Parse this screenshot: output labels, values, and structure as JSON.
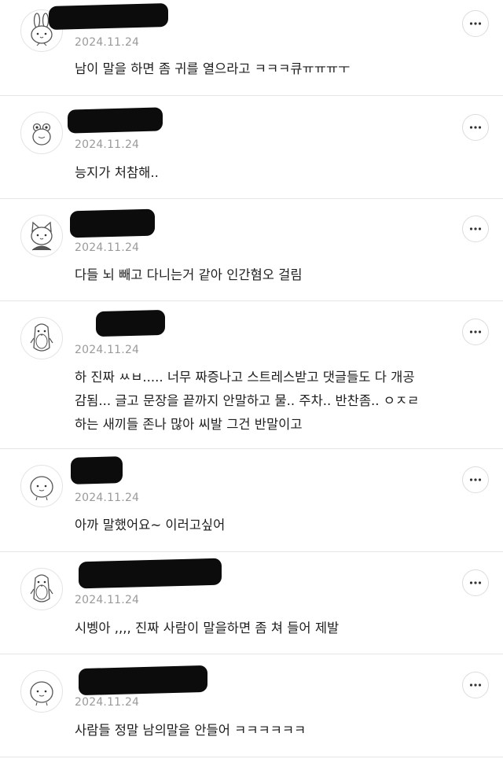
{
  "comments": [
    {
      "date": "2024.11.24",
      "text": "남이 말을 하면 좀 귀를 열으라고 ㅋㅋㅋ큐ㅠㅠㅠㅜ",
      "avatar_icon": "bunny-avatar-icon",
      "more_icon": "more-options-icon"
    },
    {
      "date": "2024.11.24",
      "text": "능지가 처참해..",
      "avatar_icon": "frog-avatar-icon",
      "more_icon": "more-options-icon"
    },
    {
      "date": "2024.11.24",
      "text": "다들 뇌 빼고 다니는거 같아 인간혐오 걸림",
      "avatar_icon": "cat-avatar-icon",
      "more_icon": "more-options-icon"
    },
    {
      "date": "2024.11.24",
      "text": "하 진짜 ㅆㅂ..... 너무 짜증나고 스트레스받고 댓글들도 다 개공\n감됨... 글고 문장을 끝까지 안말하고 물.. 주차.. 반찬좀.. ㅇㅈㄹ\n하는 새끼들 존나 많아 씨발 그건 반말이고",
      "avatar_icon": "penguin-avatar-icon",
      "more_icon": "more-options-icon"
    },
    {
      "date": "2024.11.24",
      "text": "아까 말했어요~ 이러고싶어",
      "avatar_icon": "blob-avatar-icon",
      "more_icon": "more-options-icon"
    },
    {
      "date": "2024.11.24",
      "text": "시벵아 ,,,, 진짜 사람이 말을하면 좀 쳐 들어 제발",
      "avatar_icon": "penguin-avatar-icon",
      "more_icon": "more-options-icon"
    },
    {
      "date": "2024.11.24",
      "text": "사람들 정말 남의말을 안들어 ㅋㅋㅋㅋㅋㅋ",
      "avatar_icon": "blob-avatar-icon",
      "more_icon": "more-options-icon"
    }
  ],
  "colors": {
    "date": "#9a9a9a",
    "text": "#1e1e1e",
    "divider": "#e6e6e6",
    "redaction": "#0c0c0c"
  }
}
